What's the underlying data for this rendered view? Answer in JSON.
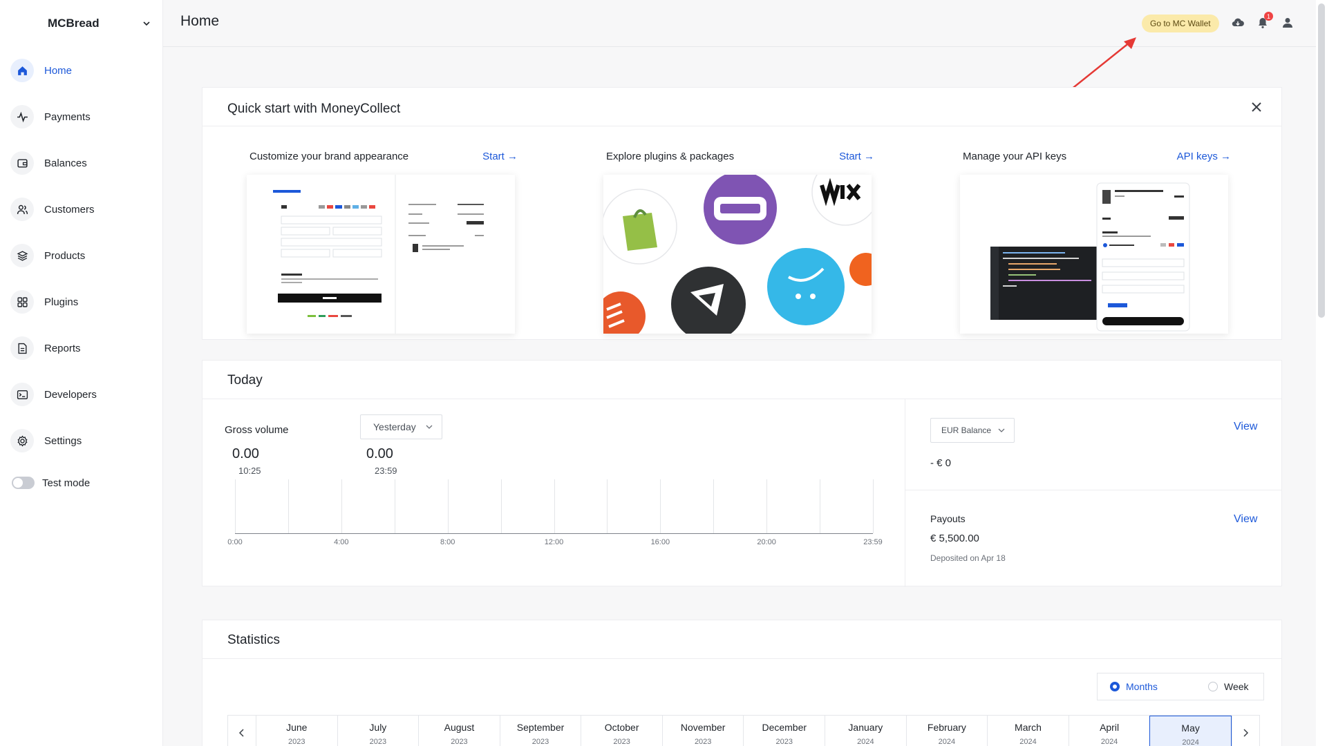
{
  "sidebar": {
    "org_name": "MCBread",
    "items": [
      {
        "label": "Home",
        "icon": "home-icon"
      },
      {
        "label": "Payments",
        "icon": "activity-icon"
      },
      {
        "label": "Balances",
        "icon": "wallet-icon"
      },
      {
        "label": "Customers",
        "icon": "users-icon"
      },
      {
        "label": "Products",
        "icon": "layers-icon"
      },
      {
        "label": "Plugins",
        "icon": "grid-icon"
      },
      {
        "label": "Reports",
        "icon": "file-icon"
      },
      {
        "label": "Developers",
        "icon": "terminal-icon"
      },
      {
        "label": "Settings",
        "icon": "gear-icon"
      }
    ],
    "test_mode_label": "Test mode"
  },
  "header": {
    "title": "Home",
    "wallet_button": "Go to MC Wallet",
    "notification_count": "1"
  },
  "quick_start": {
    "title": "Quick start with MoneyCollect",
    "columns": [
      {
        "label": "Customize your brand appearance",
        "link": "Start →"
      },
      {
        "label": "Explore plugins & packages",
        "link": "Start →"
      },
      {
        "label": "Manage your API keys",
        "link": "API keys →"
      }
    ]
  },
  "today": {
    "title": "Today",
    "gross_label": "Gross volume",
    "period_select": "Yesterday",
    "current_value": "0.00",
    "current_time": "10:25",
    "previous_value": "0.00",
    "previous_time": "23:59",
    "x_ticks": [
      "0:00",
      "4:00",
      "8:00",
      "12:00",
      "16:00",
      "20:00",
      "23:59"
    ],
    "balance_select": "EUR Balance",
    "balance_value": "- € 0",
    "balance_view": "View",
    "payouts_label": "Payouts",
    "payouts_value": "€ 5,500.00",
    "payouts_sub": "Deposited on Apr 18",
    "payouts_view": "View"
  },
  "statistics": {
    "title": "Statistics",
    "radio_months": "Months",
    "radio_week": "Week",
    "months": [
      {
        "m": "June",
        "y": "2023"
      },
      {
        "m": "July",
        "y": "2023"
      },
      {
        "m": "August",
        "y": "2023"
      },
      {
        "m": "September",
        "y": "2023"
      },
      {
        "m": "October",
        "y": "2023"
      },
      {
        "m": "November",
        "y": "2023"
      },
      {
        "m": "December",
        "y": "2023"
      },
      {
        "m": "January",
        "y": "2024"
      },
      {
        "m": "February",
        "y": "2024"
      },
      {
        "m": "March",
        "y": "2024"
      },
      {
        "m": "April",
        "y": "2024"
      },
      {
        "m": "May",
        "y": "2024"
      }
    ],
    "selected_month": "May"
  },
  "colors": {
    "accent": "#1c58d9",
    "wallet_bg": "#fbeaaa",
    "annotation_arrow": "#e53935"
  }
}
